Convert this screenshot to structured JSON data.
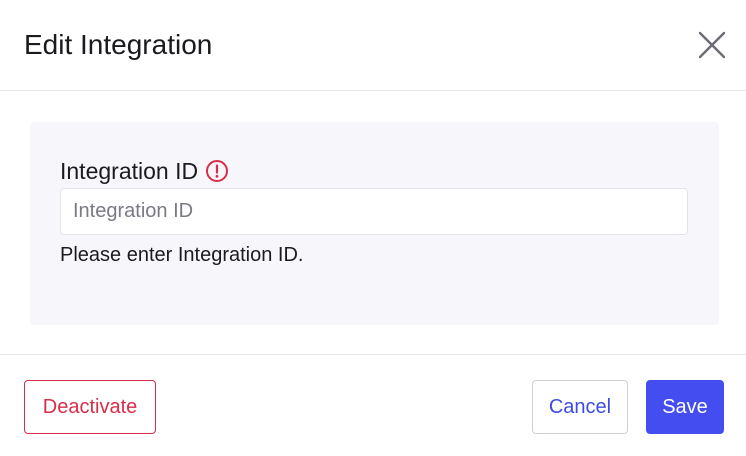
{
  "dialog": {
    "title": "Edit Integration",
    "close_icon": "close-icon"
  },
  "form": {
    "integration_id": {
      "label": "Integration ID",
      "warning_icon": "alert-circle-icon",
      "value": "",
      "placeholder": "Integration ID",
      "helper_text": "Please enter Integration ID."
    }
  },
  "footer": {
    "deactivate_label": "Deactivate",
    "cancel_label": "Cancel",
    "save_label": "Save"
  },
  "colors": {
    "danger": "#d92d4a",
    "primary": "#434df0",
    "panel_bg": "#f7f7fb"
  }
}
